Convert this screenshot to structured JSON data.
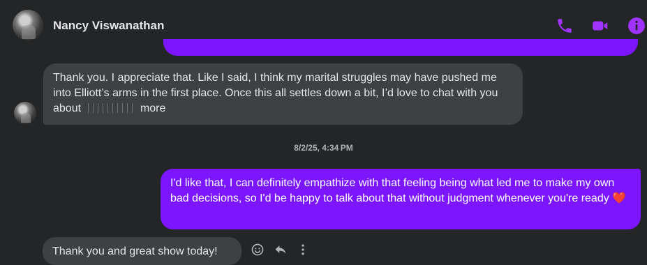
{
  "header": {
    "contact_name": "Nancy Viswanathan",
    "icons": [
      "phone-icon",
      "video-icon",
      "info-icon"
    ],
    "accent": "#a033ff"
  },
  "messages": [
    {
      "direction": "incoming",
      "text_before": "Thank you. I appreciate that. Like I said, I think my marital struggles may have pushed me into Elliott’s arms in the first place. Once this all settles down a bit, I’d love to chat with you about",
      "text_after": "more"
    },
    {
      "direction": "outgoing",
      "text": "I'd like that, I can definitely empathize with that feeling being what led me to make my own bad decisions, so I'd be happy to talk about that without judgment whenever you're ready",
      "emoji": "❤️"
    },
    {
      "direction": "incoming",
      "text": "Thank you and great show today!"
    }
  ],
  "timestamp": "8/2/25, 4:34 PM",
  "message_actions": [
    "emoji-react-icon",
    "reply-icon",
    "more-options-icon"
  ],
  "colors": {
    "background": "#242526",
    "incoming_bubble": "#3e4042",
    "outgoing_bubble": "#7b16ff"
  }
}
